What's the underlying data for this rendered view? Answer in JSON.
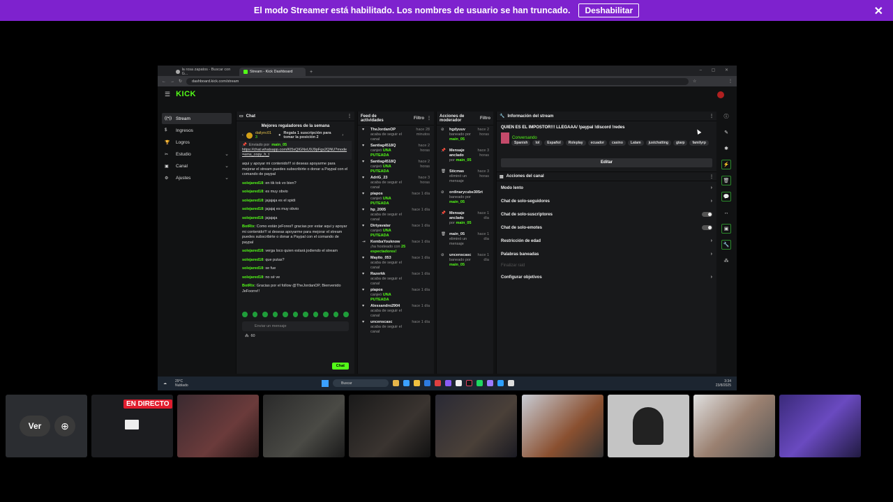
{
  "banner": {
    "message": "El modo Streamer está habilitado. Los nombres de usuario se han truncado.",
    "disable_label": "Deshabilitar",
    "close_icon": "close-icon"
  },
  "browser": {
    "tabs": [
      {
        "label": "la rosa zapatos - Buscar con G..."
      },
      {
        "label": "Stream - Kick Dashboard"
      }
    ],
    "new_tab": "+",
    "url": "dashboard.kick.com/stream"
  },
  "kick": {
    "logo": "KICK",
    "sidebar": [
      {
        "label": "Stream",
        "icon": "broadcast-icon",
        "active": true,
        "chevron": ""
      },
      {
        "label": "Ingresos",
        "icon": "dollar-icon",
        "active": false,
        "chevron": ""
      },
      {
        "label": "Logros",
        "icon": "trophy-icon",
        "active": false,
        "chevron": ""
      },
      {
        "label": "Estudio",
        "icon": "studio-icon",
        "active": false,
        "chevron": "⌄"
      },
      {
        "label": "Canal",
        "icon": "channel-icon",
        "active": false,
        "chevron": "⌄"
      },
      {
        "label": "Ajustes",
        "icon": "gear-icon",
        "active": false,
        "chevron": "⌄"
      }
    ],
    "chat": {
      "title": "Chat",
      "top_gifters": "Mejores regaladores de la semana",
      "gifter_name": "dailync01",
      "gifter_count": "3",
      "gift_prompt": "Regala 1 suscripción para tomar la posición 2",
      "pinned_by_label": "Enviado por",
      "pinned_by_user": "main_05",
      "pinned_link": "https://chat.whatsapp.com/Kl5xQIGNxU9J9pFgs2QNU?mode=ems_copy_h_t",
      "messages": [
        {
          "user": "",
          "text": "aqui y apoyar mi contenido!!! si deseas apoyarme para mejorar el stream puedes subscribirte o donar a Paypal con el comando de paypal"
        },
        {
          "user": "solejared18",
          "text": ": en tik tok vo bien?"
        },
        {
          "user": "solejared18",
          "text": ": es muy obvio"
        },
        {
          "user": "solejared18",
          "text": ": jajajaja es el spidi"
        },
        {
          "user": "solejared18",
          "text": ": jajajaj es muy obvio"
        },
        {
          "user": "solejared18",
          "text": ": jajajaja"
        },
        {
          "user": "BotRix",
          "text": ": Como están jeFores!! gracias por estar aqui y apoyar mi contenido!!! si deseas apoyarme para mejorar el stream puedes subscribirte o donar a Paypal con el comando de paypal"
        },
        {
          "user": "solejared18",
          "text": ": verga loco quien estará jodiendo el stream"
        },
        {
          "user": "solejared18",
          "text": ": que putas?"
        },
        {
          "user": "solejared18",
          "text": ": se fue"
        },
        {
          "user": "solejared18",
          "text": ": no sé ve"
        },
        {
          "user": "BotRix",
          "text": ": Gracias por el follow @TheJordanOP, Bienvenido JeFoorre!!"
        }
      ],
      "input_placeholder": "Enviar un mensaje",
      "points": "60",
      "send_label": "Chat"
    },
    "feed": {
      "title": "Feed de actividades",
      "filter_label": "Filtro",
      "items": [
        {
          "icon": "heart-icon",
          "name": "TheJordanOP",
          "sub": "acaba de seguir el canal",
          "highlight": "",
          "time": "hace 28 minutos"
        },
        {
          "icon": "heart-icon",
          "name": "Santiag4518Q",
          "sub": "canjeó",
          "highlight": "UNA PUTEADA",
          "time": "hace 2 horas"
        },
        {
          "icon": "heart-icon",
          "name": "Santiag4518Q",
          "sub": "canjeó",
          "highlight": "UNA PUTEADA",
          "time": "hace 2 horas"
        },
        {
          "icon": "heart-icon",
          "name": "AdriG_23",
          "sub": "acaba de seguir el canal",
          "highlight": "",
          "time": "hace 3 horas"
        },
        {
          "icon": "heart-icon",
          "name": "piapos",
          "sub": "canjeó",
          "highlight": "UNA PUTEADA",
          "time": "hace 1 día"
        },
        {
          "icon": "heart-icon",
          "name": "hp_2005",
          "sub": "acaba de seguir el canal",
          "highlight": "",
          "time": "hace 1 día"
        },
        {
          "icon": "heart-icon",
          "name": "Dirtyavatar",
          "sub": "canjeó",
          "highlight": "UNA PUTEADA",
          "time": "hace 1 día"
        },
        {
          "icon": "host-icon",
          "name": "KembaYouknow",
          "sub": "¡ha hosteado con",
          "highlight": "25 espectadores!",
          "time": "hace 1 día"
        },
        {
          "icon": "heart-icon",
          "name": "Mayito_053",
          "sub": "acaba de seguir el canal",
          "highlight": "",
          "time": "hace 1 día"
        },
        {
          "icon": "heart-icon",
          "name": "Razerkk",
          "sub": "acaba de seguir el canal",
          "highlight": "",
          "time": "hace 1 día"
        },
        {
          "icon": "heart-icon",
          "name": "piapos",
          "sub": "canjeó",
          "highlight": "UNA PUTEADA",
          "time": "hace 1 día"
        },
        {
          "icon": "heart-icon",
          "name": "Alessandro2904",
          "sub": "acaba de seguir el canal",
          "highlight": "",
          "time": "hace 1 día"
        },
        {
          "icon": "heart-icon",
          "name": "uncenscasc",
          "sub": "acaba de seguir el canal",
          "highlight": "",
          "time": "hace 1 día"
        }
      ]
    },
    "mod": {
      "title": "Acciones de moderador",
      "filter_label": "Filtro",
      "items": [
        {
          "icon": "ban-icon",
          "name": "hgdyuuv",
          "sub": "baneado por",
          "by": "main_05",
          "time": "hace 2 horas"
        },
        {
          "icon": "pin-icon",
          "name": "Mensaje anclado",
          "sub": "por",
          "by": "main_05",
          "time": "hace 3 horas"
        },
        {
          "icon": "trash-icon",
          "name": "Sticmas",
          "sub": "eliminó un mensaje",
          "by": "",
          "time": "hace 3 horas"
        },
        {
          "icon": "ban-icon",
          "name": "ordinarycube305rt",
          "sub": "baneado por",
          "by": "main_05",
          "time": ""
        },
        {
          "icon": "pin-icon",
          "name": "Mensaje anclado",
          "sub": "por",
          "by": "main_05",
          "time": "hace 1 día"
        },
        {
          "icon": "trash-icon",
          "name": "main_05",
          "sub": "eliminó un mensaje",
          "by": "",
          "time": "hace 1 día"
        },
        {
          "icon": "ban-icon",
          "name": "uncenscasc",
          "sub": "baneado por",
          "by": "main_05",
          "time": "hace 1 día"
        }
      ]
    },
    "info": {
      "title": "Información del stream",
      "stream_title": "QUIEN ES EL IMPOSTOR!!! LLEGAAA/ !paypal !discord !redes",
      "category": "Conversando",
      "tags": [
        "Spanish",
        "lol",
        "Español",
        "Roleplay",
        "ecuador",
        "casino",
        "Latam",
        "justchatting",
        "gtarp",
        "familyrp"
      ],
      "edit_label": "Editar"
    },
    "channel_actions": {
      "title": "Acciones del canal",
      "items": [
        {
          "label": "Modo lento",
          "control": "chevron"
        },
        {
          "label": "Chat de solo-seguidores",
          "control": "chevron"
        },
        {
          "label": "Chat de solo-suscriptores",
          "control": "toggle"
        },
        {
          "label": "Chat de solo-emotes",
          "control": "toggle"
        },
        {
          "label": "Restricción de edad",
          "control": "chevron"
        },
        {
          "label": "Palabras baneadas",
          "control": "chevron"
        },
        {
          "label": "Finalizar raid",
          "control": "disabled"
        },
        {
          "label": "Configurar objetivos",
          "control": "chevron"
        }
      ]
    }
  },
  "taskbar": {
    "temp": "29°C",
    "weather": "Nublado",
    "search_placeholder": "Buscar",
    "time": "3:34",
    "date": "23/8/2025"
  },
  "thumbnails": {
    "ver_label": "Ver",
    "live_badge": "EN DIRECTO"
  }
}
